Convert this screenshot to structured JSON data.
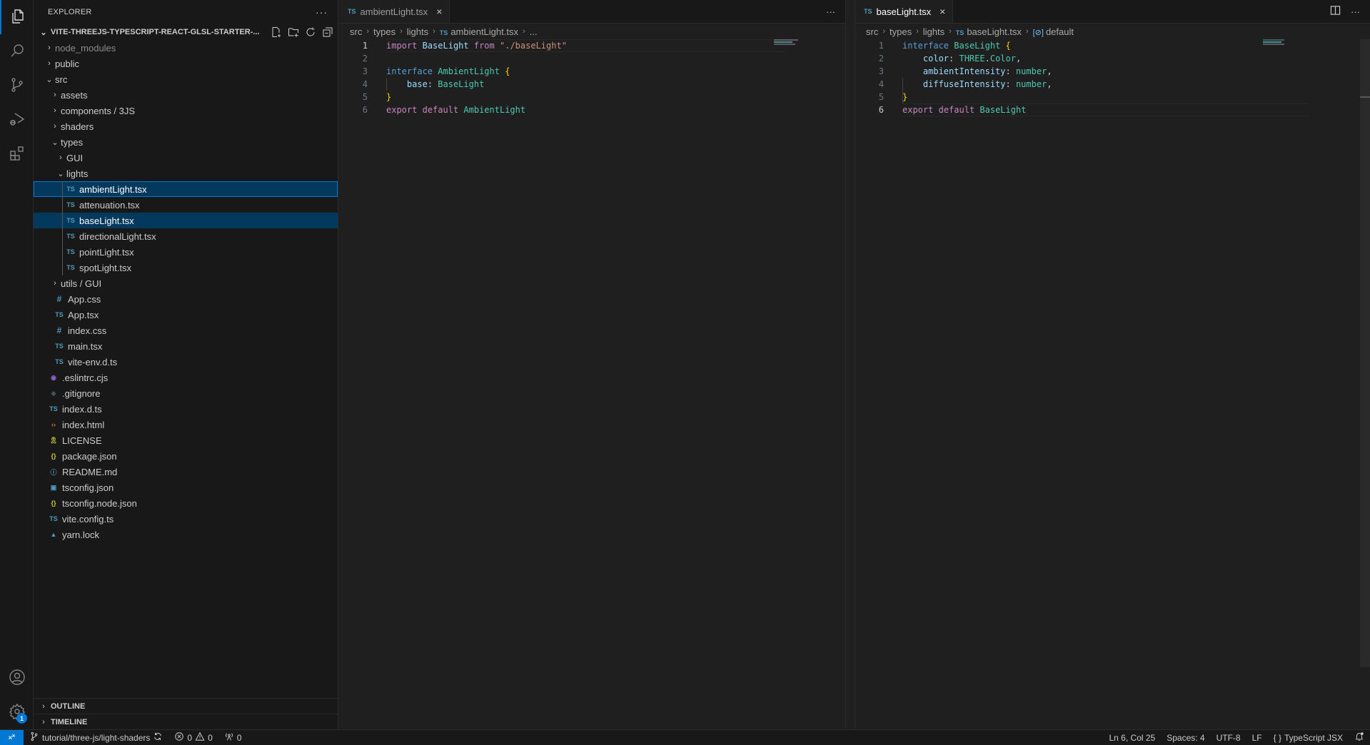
{
  "activity_bar": {
    "items": [
      {
        "name": "explorer",
        "icon": "files-icon",
        "active": true
      },
      {
        "name": "search",
        "icon": "search-icon"
      },
      {
        "name": "source-control",
        "icon": "source-control-icon"
      },
      {
        "name": "run-debug",
        "icon": "run-debug-icon"
      },
      {
        "name": "extensions",
        "icon": "extensions-icon"
      }
    ],
    "bottom": [
      {
        "name": "accounts",
        "icon": "account-icon"
      },
      {
        "name": "manage",
        "icon": "gear-icon",
        "badge": "1"
      }
    ]
  },
  "sidebar": {
    "title": "EXPLORER",
    "more_label": "···",
    "root": "VITE-THREEJS-TYPESCRIPT-REACT-GLSL-STARTER-...",
    "tree": [
      {
        "label": "node_modules",
        "kind": "folder",
        "open": false,
        "depth": 1,
        "dim": true
      },
      {
        "label": "public",
        "kind": "folder",
        "open": false,
        "depth": 1
      },
      {
        "label": "src",
        "kind": "folder",
        "open": true,
        "depth": 1
      },
      {
        "label": "assets",
        "kind": "folder",
        "open": false,
        "depth": 2
      },
      {
        "label": "components / 3JS",
        "kind": "folder",
        "open": false,
        "depth": 2
      },
      {
        "label": "shaders",
        "kind": "folder",
        "open": false,
        "depth": 2
      },
      {
        "label": "types",
        "kind": "folder",
        "open": true,
        "depth": 2
      },
      {
        "label": "GUI",
        "kind": "folder",
        "open": false,
        "depth": 3
      },
      {
        "label": "lights",
        "kind": "folder",
        "open": true,
        "depth": 3
      },
      {
        "label": "ambientLight.tsx",
        "kind": "ts",
        "depth": 4,
        "state": "selected"
      },
      {
        "label": "attenuation.tsx",
        "kind": "ts",
        "depth": 4
      },
      {
        "label": "baseLight.tsx",
        "kind": "ts",
        "depth": 4,
        "state": "active"
      },
      {
        "label": "directionalLight.tsx",
        "kind": "ts",
        "depth": 4
      },
      {
        "label": "pointLight.tsx",
        "kind": "ts",
        "depth": 4
      },
      {
        "label": "spotLight.tsx",
        "kind": "ts",
        "depth": 4
      },
      {
        "label": "utils / GUI",
        "kind": "folder",
        "open": false,
        "depth": 2
      },
      {
        "label": "App.css",
        "kind": "css",
        "depth": 2
      },
      {
        "label": "App.tsx",
        "kind": "ts",
        "depth": 2
      },
      {
        "label": "index.css",
        "kind": "css",
        "depth": 2
      },
      {
        "label": "main.tsx",
        "kind": "ts",
        "depth": 2
      },
      {
        "label": "vite-env.d.ts",
        "kind": "ts",
        "depth": 2
      },
      {
        "label": ".eslintrc.cjs",
        "kind": "eslint",
        "depth": 1
      },
      {
        "label": ".gitignore",
        "kind": "git",
        "depth": 1
      },
      {
        "label": "index.d.ts",
        "kind": "ts",
        "depth": 1
      },
      {
        "label": "index.html",
        "kind": "html",
        "depth": 1
      },
      {
        "label": "LICENSE",
        "kind": "license",
        "depth": 1
      },
      {
        "label": "package.json",
        "kind": "json",
        "depth": 1
      },
      {
        "label": "README.md",
        "kind": "info",
        "depth": 1
      },
      {
        "label": "tsconfig.json",
        "kind": "tsconfig",
        "depth": 1
      },
      {
        "label": "tsconfig.node.json",
        "kind": "json",
        "depth": 1
      },
      {
        "label": "vite.config.ts",
        "kind": "ts",
        "depth": 1
      },
      {
        "label": "yarn.lock",
        "kind": "yarn",
        "depth": 1
      }
    ],
    "panels": [
      "OUTLINE",
      "TIMELINE"
    ]
  },
  "editor_left": {
    "tab": {
      "badge": "TS",
      "label": "ambientLight.tsx",
      "close": "×"
    },
    "more_label": "···",
    "breadcrumb": [
      "src",
      "types",
      "lights",
      "ambientLight.tsx",
      "..."
    ],
    "cursor_line": 1,
    "lines": [
      [
        [
          "kw-ctrl",
          "import"
        ],
        [
          "punct",
          " "
        ],
        [
          "prop",
          "BaseLight"
        ],
        [
          "punct",
          " "
        ],
        [
          "kw-ctrl",
          "from"
        ],
        [
          "punct",
          " "
        ],
        [
          "str",
          "\"./baseLight\""
        ]
      ],
      [],
      [
        [
          "kw",
          "interface"
        ],
        [
          "punct",
          " "
        ],
        [
          "type",
          "AmbientLight"
        ],
        [
          "punct",
          " "
        ],
        [
          "brace",
          "{"
        ]
      ],
      [
        [
          "punct",
          "    "
        ],
        [
          "prop",
          "base"
        ],
        [
          "punct",
          ": "
        ],
        [
          "type",
          "BaseLight"
        ]
      ],
      [
        [
          "brace",
          "}"
        ]
      ],
      [
        [
          "kw-ctrl",
          "export"
        ],
        [
          "punct",
          " "
        ],
        [
          "kw-ctrl",
          "default"
        ],
        [
          "punct",
          " "
        ],
        [
          "type",
          "AmbientLight"
        ]
      ]
    ]
  },
  "editor_right": {
    "tab": {
      "badge": "TS",
      "label": "baseLight.tsx",
      "close": "×"
    },
    "more_label": "···",
    "breadcrumb": [
      "src",
      "types",
      "lights",
      "baseLight.tsx",
      "default"
    ],
    "cursor_line": 6,
    "lines": [
      [
        [
          "kw",
          "interface"
        ],
        [
          "punct",
          " "
        ],
        [
          "type",
          "BaseLight"
        ],
        [
          "punct",
          " "
        ],
        [
          "brace",
          "{"
        ]
      ],
      [
        [
          "punct",
          "    "
        ],
        [
          "prop",
          "color"
        ],
        [
          "punct",
          ": "
        ],
        [
          "type",
          "THREE"
        ],
        [
          "punct",
          "."
        ],
        [
          "type",
          "Color"
        ],
        [
          "punct",
          ","
        ]
      ],
      [
        [
          "punct",
          "    "
        ],
        [
          "prop",
          "ambientIntensity"
        ],
        [
          "punct",
          ": "
        ],
        [
          "type",
          "number"
        ],
        [
          "punct",
          ","
        ]
      ],
      [
        [
          "punct",
          "    "
        ],
        [
          "prop",
          "diffuseIntensity"
        ],
        [
          "punct",
          ": "
        ],
        [
          "type",
          "number"
        ],
        [
          "punct",
          ","
        ]
      ],
      [
        [
          "brace",
          "}"
        ]
      ],
      [
        [
          "kw-ctrl",
          "export"
        ],
        [
          "punct",
          " "
        ],
        [
          "kw-ctrl",
          "default"
        ],
        [
          "punct",
          " "
        ],
        [
          "type",
          "BaseLight"
        ]
      ]
    ]
  },
  "status_bar": {
    "branch": "tutorial/three-js/light-shaders",
    "errors": "0",
    "warnings": "0",
    "ports": "0",
    "cursor": "Ln 6, Col 25",
    "spaces": "Spaces: 4",
    "encoding": "UTF-8",
    "eol": "LF",
    "language": "TypeScript JSX"
  },
  "colors": {
    "accent": "#0078d4",
    "selection": "#04395e"
  }
}
